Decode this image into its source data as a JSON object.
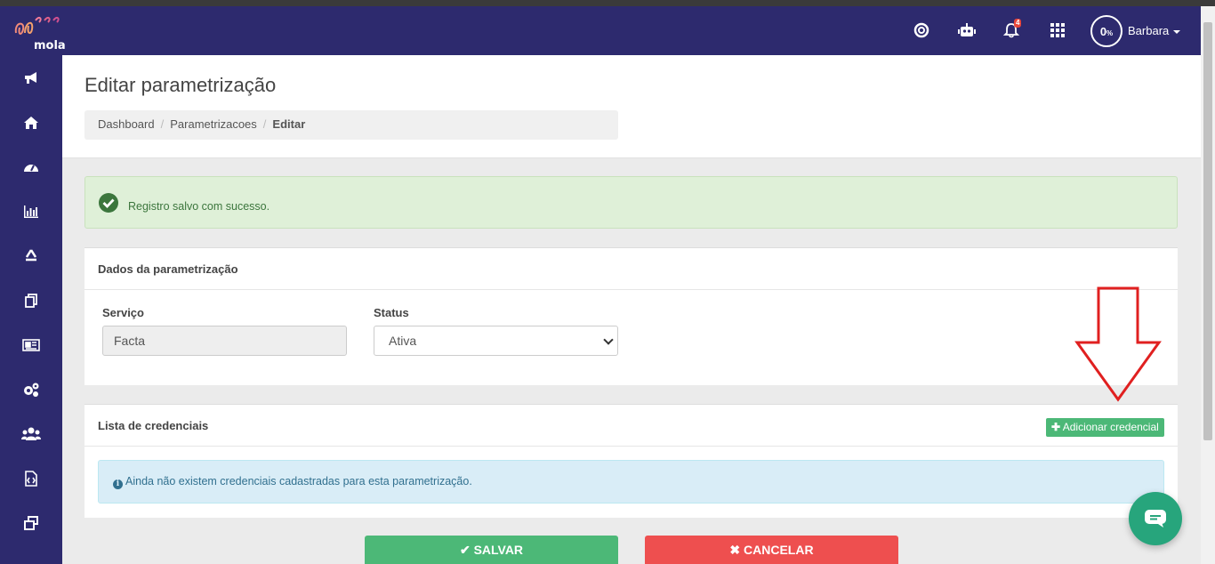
{
  "brand": {
    "logo_text": "mola"
  },
  "topbar": {
    "icons": [
      "lifebuoy-icon",
      "robot-icon",
      "bell-icon",
      "apps-grid-icon"
    ],
    "notification_count": "4",
    "progress_value": "0",
    "progress_unit": "%",
    "user_name": "Barbara"
  },
  "sidebar": {
    "icons": [
      "megaphone-icon",
      "home-icon",
      "dashboard-gauge-icon",
      "bar-chart-icon",
      "recycle-icon",
      "documents-icon",
      "newspaper-icon",
      "gears-icon",
      "users-icon",
      "code-file-icon",
      "windows-icon"
    ]
  },
  "page": {
    "title": "Editar parametrização",
    "breadcrumb": [
      "Dashboard",
      "Parametrizacoes",
      "Editar"
    ]
  },
  "alert_success": {
    "message": "Registro salvo com sucesso."
  },
  "panel_dados": {
    "heading": "Dados da parametrização",
    "servico_label": "Serviço",
    "servico_value": "Facta",
    "status_label": "Status",
    "status_value": "Ativa"
  },
  "panel_credenciais": {
    "heading": "Lista de credenciais",
    "add_button": "Adicionar credencial",
    "empty_message": "Ainda não existem credenciais cadastradas para esta parametrização."
  },
  "actions": {
    "save": "SALVAR",
    "cancel": "CANCELAR"
  },
  "colors": {
    "navbar": "#2d2a6e",
    "success": "#4cb877",
    "danger": "#ee4f4f",
    "annotation_arrow": "#e02020",
    "chat": "#27a57c"
  }
}
